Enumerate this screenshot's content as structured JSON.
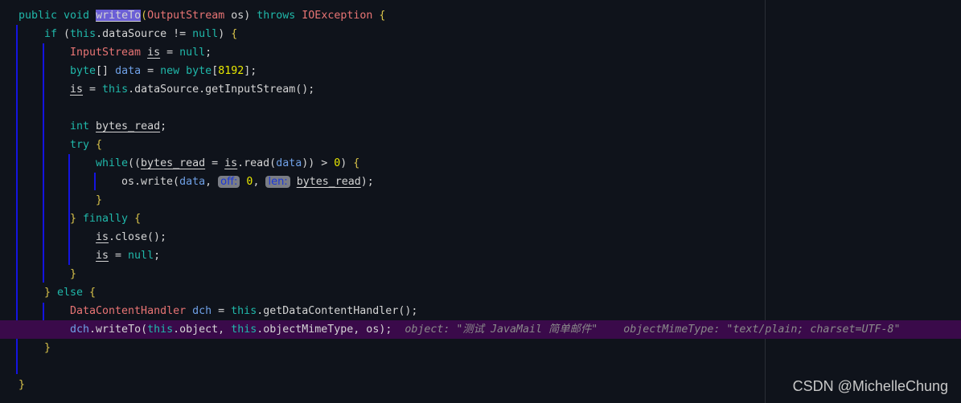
{
  "editor": {
    "current_line": 17,
    "colors": {
      "background": "#0f131b",
      "keyword": "#20b8aa",
      "type": "#e87474",
      "identifier": "#6fa0e6",
      "number": "#e8e800",
      "current_line": "#3a0a4a",
      "indent_guide": "#1414e0"
    },
    "lines": [
      {
        "indent": 0,
        "tokens": [
          [
            "public void ",
            "kw"
          ],
          [
            "writeTo",
            "pl sel ul"
          ],
          [
            "(",
            "br"
          ],
          [
            "OutputStream",
            "ty"
          ],
          [
            " os) ",
            "pl"
          ],
          [
            "throws ",
            "kw"
          ],
          [
            "IOException ",
            "ty"
          ],
          [
            "{",
            "br"
          ]
        ]
      },
      {
        "indent": 1,
        "tokens": [
          [
            "if ",
            "kw"
          ],
          [
            "(",
            "pl"
          ],
          [
            "this",
            "kw"
          ],
          [
            ".dataSource != ",
            "pl"
          ],
          [
            "null",
            "kw"
          ],
          [
            ") ",
            "pl"
          ],
          [
            "{",
            "br"
          ]
        ]
      },
      {
        "indent": 2,
        "tokens": [
          [
            "InputStream ",
            "ty"
          ],
          [
            "is",
            "pl ul"
          ],
          [
            " = ",
            "pl"
          ],
          [
            "null",
            "kw"
          ],
          [
            ";",
            "pl"
          ]
        ]
      },
      {
        "indent": 2,
        "tokens": [
          [
            "byte",
            "kw"
          ],
          [
            "[] ",
            "pl"
          ],
          [
            "data",
            "id"
          ],
          [
            " = ",
            "pl"
          ],
          [
            "new ",
            "kw"
          ],
          [
            "byte",
            "kw"
          ],
          [
            "[",
            "pl"
          ],
          [
            "8192",
            "num"
          ],
          [
            "];",
            "pl"
          ]
        ]
      },
      {
        "indent": 2,
        "tokens": [
          [
            "is",
            "pl ul"
          ],
          [
            " = ",
            "pl"
          ],
          [
            "this",
            "kw"
          ],
          [
            ".dataSource.getInputStream();",
            "pl"
          ]
        ]
      },
      {
        "indent": 0,
        "tokens": []
      },
      {
        "indent": 2,
        "tokens": [
          [
            "int ",
            "kw"
          ],
          [
            "bytes_read",
            "pl ul"
          ],
          [
            ";",
            "pl"
          ]
        ]
      },
      {
        "indent": 2,
        "tokens": [
          [
            "try ",
            "kw"
          ],
          [
            "{",
            "br"
          ]
        ]
      },
      {
        "indent": 3,
        "tokens": [
          [
            "while",
            "kw"
          ],
          [
            "((",
            "pl"
          ],
          [
            "bytes_read",
            "pl ul"
          ],
          [
            " = ",
            "pl"
          ],
          [
            "is",
            "pl ul"
          ],
          [
            ".read(",
            "pl"
          ],
          [
            "data",
            "id"
          ],
          [
            ")) > ",
            "pl"
          ],
          [
            "0",
            "num"
          ],
          [
            ") ",
            "pl"
          ],
          [
            "{",
            "br"
          ]
        ]
      },
      {
        "indent": 4,
        "tokens": [
          [
            "os.write(",
            "pl"
          ],
          [
            "data",
            "id"
          ],
          [
            ", ",
            "pl"
          ],
          [
            "off:",
            "chip"
          ],
          [
            " ",
            "pl"
          ],
          [
            "0",
            "num"
          ],
          [
            ", ",
            "pl"
          ],
          [
            "len:",
            "chip"
          ],
          [
            " ",
            "pl"
          ],
          [
            "bytes_read",
            "pl ul"
          ],
          [
            ");",
            "pl"
          ]
        ]
      },
      {
        "indent": 3,
        "tokens": [
          [
            "}",
            "br"
          ]
        ]
      },
      {
        "indent": 2,
        "tokens": [
          [
            "} ",
            "br"
          ],
          [
            "finally ",
            "kw"
          ],
          [
            "{",
            "br"
          ]
        ]
      },
      {
        "indent": 3,
        "tokens": [
          [
            "is",
            "pl ul"
          ],
          [
            ".close();",
            "pl"
          ]
        ]
      },
      {
        "indent": 3,
        "tokens": [
          [
            "is",
            "pl ul"
          ],
          [
            " = ",
            "pl"
          ],
          [
            "null",
            "kw"
          ],
          [
            ";",
            "pl"
          ]
        ]
      },
      {
        "indent": 2,
        "tokens": [
          [
            "}",
            "br"
          ]
        ]
      },
      {
        "indent": 1,
        "tokens": [
          [
            "} ",
            "br"
          ],
          [
            "else ",
            "kw"
          ],
          [
            "{",
            "br"
          ]
        ]
      },
      {
        "indent": 2,
        "tokens": [
          [
            "DataContentHandler ",
            "ty"
          ],
          [
            "dch",
            "id"
          ],
          [
            " = ",
            "pl"
          ],
          [
            "this",
            "kw"
          ],
          [
            ".getDataContentHandler();",
            "pl"
          ]
        ]
      },
      {
        "indent": 2,
        "tokens": [
          [
            "dch",
            "id"
          ],
          [
            ".writeTo(",
            "pl"
          ],
          [
            "this",
            "kw"
          ],
          [
            ".object, ",
            "pl"
          ],
          [
            "this",
            "kw"
          ],
          [
            ".objectMimeType, os);",
            "pl"
          ],
          [
            "  object: \"测试 JavaMail 简单邮件\"    objectMimeType: \"text/plain; charset=UTF-8\"",
            "hint"
          ]
        ]
      },
      {
        "indent": 1,
        "tokens": [
          [
            "}",
            "br"
          ]
        ]
      },
      {
        "indent": 0,
        "tokens": []
      },
      {
        "indent": 0,
        "tokens": [
          [
            "}",
            "br"
          ]
        ]
      }
    ]
  },
  "watermark": "CSDN @MichelleChung"
}
